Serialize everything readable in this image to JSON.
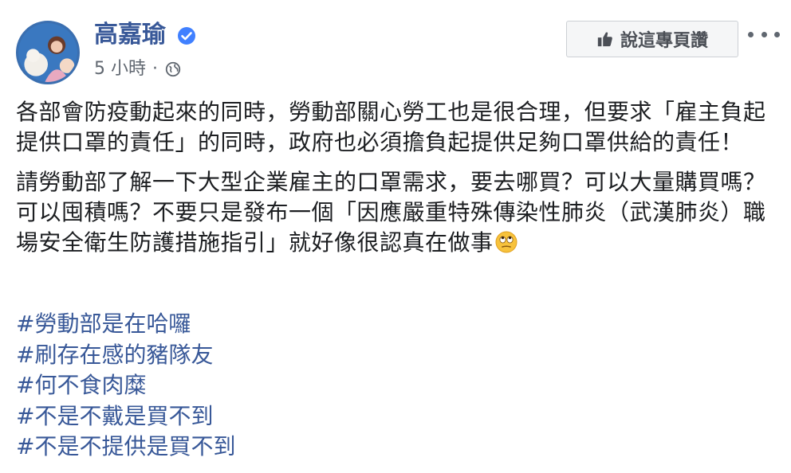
{
  "post": {
    "author": "高嘉瑜",
    "timestamp": "5 小時",
    "separator": "·",
    "like_page_label": "說這專頁讚",
    "paragraphs": [
      "各部會防疫動起來的同時，勞動部關心勞工也是很合理，但要求「雇主負起提供口罩的責任」的同時，政府也必須擔負起提供足夠口罩供給的責任！",
      "請勞動部了解一下大型企業雇主的口罩需求，要去哪買？可以大量購買嗎？可以囤積嗎？不要只是發布一個「因應嚴重特殊傳染性肺炎（武漢肺炎）職場安全衛生防護措施指引」就好像很認真在做事"
    ],
    "hashtags": [
      "#勞動部是在哈囉",
      "#刷存在感的豬隊友",
      "#何不食肉糜",
      "#不是不戴是買不到",
      "#不是不提供是買不到"
    ]
  },
  "icons": {
    "verified": "verified-badge-icon",
    "audience": "globe-icon",
    "like": "thumbs-up-icon",
    "more": "more-options-icon",
    "emoji": "rolling-eyes-emoji-icon"
  },
  "colors": {
    "link": "#385898",
    "text": "#1c1e21",
    "secondary": "#606770",
    "verified": "#4080ff"
  }
}
